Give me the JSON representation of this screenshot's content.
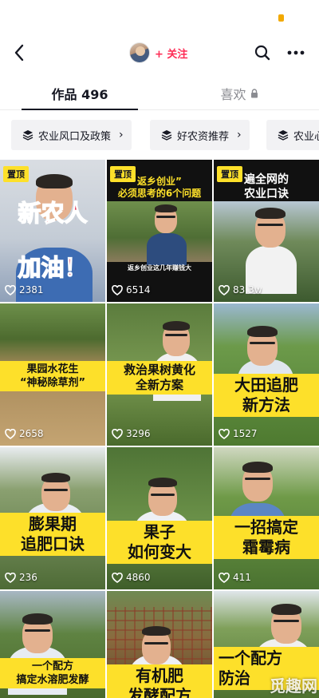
{
  "header": {
    "follow_label": "+ 关注"
  },
  "tabs": [
    {
      "label": "作品 496"
    },
    {
      "label": "喜欢"
    }
  ],
  "chips": [
    {
      "label": "农业风口及政策"
    },
    {
      "label": "好农资推荐"
    },
    {
      "label": "农业心"
    }
  ],
  "pinned_label": "置顶",
  "videos": [
    {
      "likes": "2381",
      "pinned": true,
      "caption_top": "新农人",
      "caption_bottom": "加油！"
    },
    {
      "likes": "6514",
      "pinned": true,
      "caption_lines": [
        "返乡创业”",
        "必须思考的6个问题"
      ],
      "subtitle": "返乡创业这几年赚钱大"
    },
    {
      "likes": "83.3w",
      "pinned": true,
      "caption_lines": [
        "遍全网的",
        "农业口诀"
      ]
    },
    {
      "likes": "2658",
      "caption_lines": [
        "果园水花生",
        "“神秘除草剂”"
      ]
    },
    {
      "likes": "3296",
      "caption_lines": [
        "救治果树黄化",
        "全新方案"
      ]
    },
    {
      "likes": "1527",
      "caption_lines": [
        "大田追肥",
        "新方法"
      ]
    },
    {
      "likes": "236",
      "caption_lines": [
        "膨果期",
        "追肥口诀"
      ]
    },
    {
      "likes": "4860",
      "caption_lines": [
        "果子",
        "如何变大"
      ]
    },
    {
      "likes": "411",
      "caption_lines": [
        "一招搞定",
        "霜霉病"
      ]
    },
    {
      "likes": "",
      "caption_lines": [
        "一个配方",
        "搞定水溶肥发酵"
      ]
    },
    {
      "likes": "",
      "caption_lines": [
        "有机肥",
        "发酵配方"
      ]
    },
    {
      "likes": "",
      "caption_lines": [
        "一个配方",
        "防治"
      ]
    }
  ],
  "watermark": "觅趣网",
  "colors": {
    "accent": "#fe2c55",
    "caption_yellow": "#fde02a",
    "chip_bg": "#f2f2f4"
  }
}
